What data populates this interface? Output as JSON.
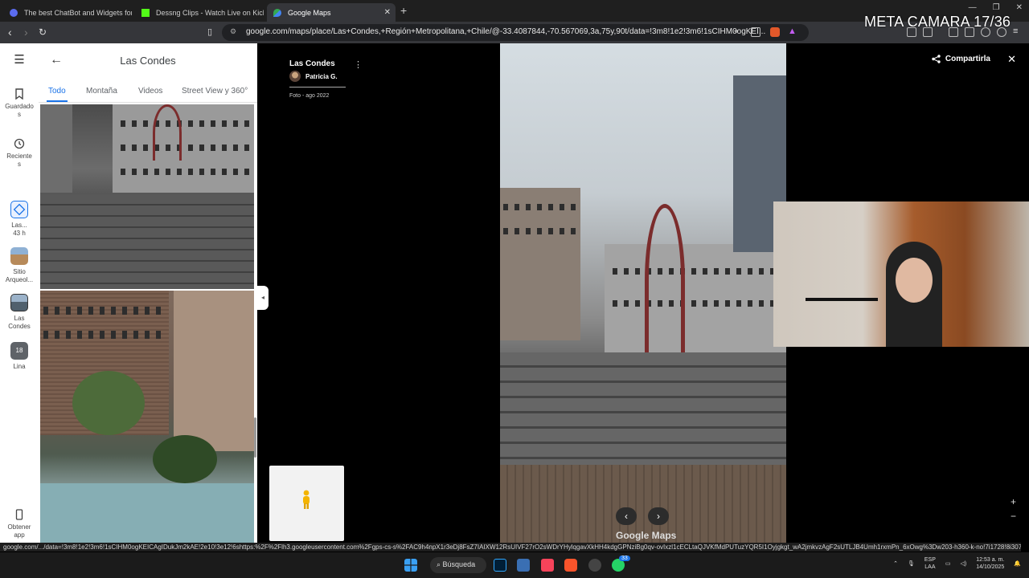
{
  "browser": {
    "tabs": [
      {
        "title": "The best ChatBot and Widgets for Ki",
        "active": false
      },
      {
        "title": "Dessng Clips - Watch Live on Kick",
        "active": false
      },
      {
        "title": "Google Maps",
        "active": true
      }
    ],
    "url": "google.com/maps/place/Las+Condes,+Región+Metropolitana,+Chile/@-33.4087844,-70.567069,3a,75y,90t/data=!3m8!1e2!3m6!1sCIHM0ogKEI..."
  },
  "overlay_label": "META CAMARA 17/36",
  "rail": {
    "items": [
      {
        "label": "Guardado\ns",
        "icon": "bookmark-icon"
      },
      {
        "label": "Reciente\ns",
        "icon": "history-icon"
      },
      {
        "label": "Las...\n43 h",
        "icon": "directions-icon"
      },
      {
        "label": "Sitio\nArqueol...",
        "icon": "place-thumbnail"
      },
      {
        "label": "Las\nCondes",
        "icon": "place-thumbnail"
      },
      {
        "label": "Lina",
        "icon": "calendar-icon",
        "badge": "18"
      },
      {
        "label": "Obtener\napp",
        "icon": "phone-icon"
      }
    ]
  },
  "panel": {
    "title": "Las Condes",
    "tabs": [
      "Todo",
      "Montaña",
      "Videos",
      "Street View y 360°"
    ],
    "selected_tab": "Todo"
  },
  "viewer": {
    "place_name": "Las Condes",
    "author": "Patricia G.",
    "date": "Foto - ago 2022",
    "share_label": "Compartirla",
    "brand": "Google Maps",
    "zoom_in": "+",
    "zoom_out": "−"
  },
  "status_url": "google.com/.../data=!3m8!1e2!3m6!1sCIHM0ogKEICAgIDukJm2kAE!2e10!3e12!6shttps:%2F%2Flh3.googleusercontent.com%2Fgps-cs-s%2FAC9h4npX1r3eDj8FsZ7IAIXW12RsUIVF27rO2sWDrYHylqgavXkHH4kdgGPNziBg0qv-ovIxzl1cECLtaQJVKfMdPUTuzYQR5I1Oyjgkgt_wA2jmkvzAgF2sUTLJB4Umh1rxmPn_6xOwg%3Dw203-h360-k-no!7i1728!8i3072!4m...",
  "taskbar": {
    "search_label": "Búsqueda",
    "notification_badge": "33",
    "lang_top": "ESP",
    "lang_bottom": "LAA",
    "time": "12:53 a. m.",
    "date": "14/10/2025"
  },
  "colors": {
    "accent": "#1a73e8",
    "chrome_dark": "#1f1f1f",
    "chrome_mid": "#35363a"
  }
}
